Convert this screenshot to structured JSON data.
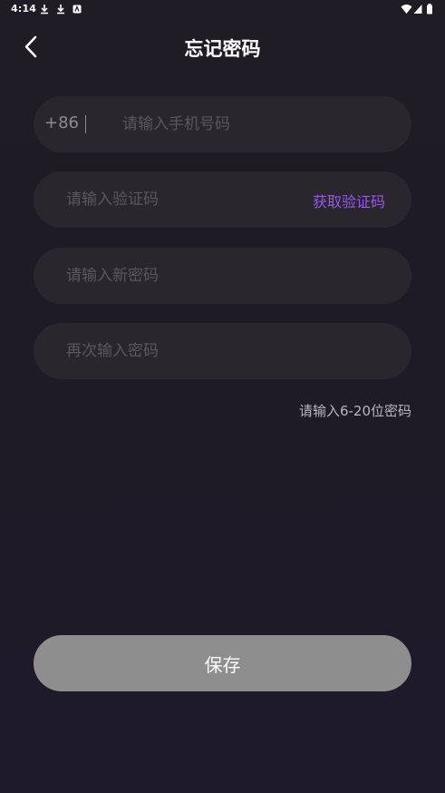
{
  "status_bar": {
    "time": "4:14",
    "left_icons": [
      "download-icon",
      "download-icon",
      "notification-app-icon"
    ],
    "right_icons": [
      "wifi-icon",
      "signal-icon",
      "battery-icon"
    ]
  },
  "header": {
    "title": "忘记密码",
    "back_icon": "chevron-left-icon"
  },
  "form": {
    "phone": {
      "country_code": "+86",
      "placeholder": "请输入手机号码",
      "value": ""
    },
    "verification_code": {
      "placeholder": "请输入验证码",
      "value": "",
      "get_code_label": "获取验证码"
    },
    "new_password": {
      "placeholder": "请输入新密码",
      "value": ""
    },
    "confirm_password": {
      "placeholder": "再次输入密码",
      "value": ""
    },
    "hint": "请输入6-20位密码"
  },
  "actions": {
    "save_label": "保存"
  },
  "colors": {
    "background": "#1f1c25",
    "field_background": "#29262e",
    "accent": "#9a56f0",
    "save_button": "#8e8e8e",
    "placeholder": "#5a5760"
  }
}
